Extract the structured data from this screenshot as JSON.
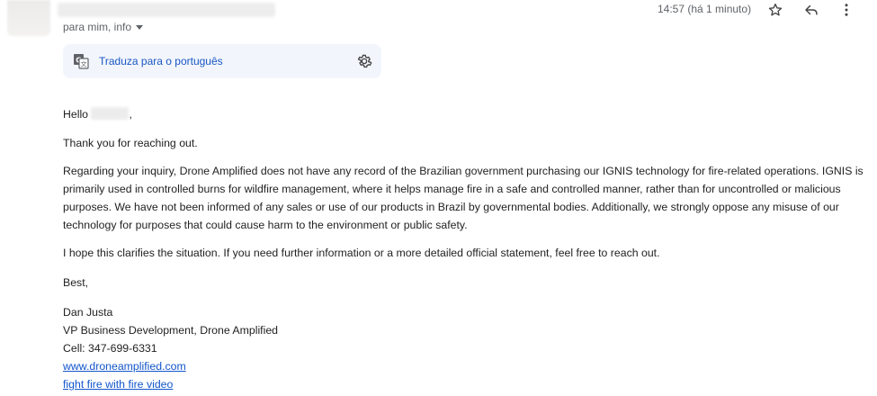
{
  "header": {
    "recipients": "para mim, info",
    "timestamp": "14:57 (há 1 minuto)",
    "icons": [
      "star-icon",
      "reply-icon",
      "more-vert-icon"
    ]
  },
  "translate": {
    "label": "Traduza para o português",
    "icons": [
      "translate-icon",
      "gear-icon"
    ]
  },
  "email": {
    "greeting": "Hello",
    "greeting_suffix": ",",
    "thanks": "Thank you for reaching out.",
    "paragraph1": "Regarding your inquiry, Drone Amplified does not have any record of the Brazilian government purchasing our IGNIS technology for fire-related operations. IGNIS is primarily used in controlled burns for wildfire management, where it helps manage fire in a safe and controlled manner, rather than for uncontrolled or malicious purposes. We have not been informed of any sales or use of our products in Brazil by governmental bodies. Additionally, we strongly oppose any misuse of our technology for purposes that could cause harm to the environment or public safety.",
    "paragraph2": "I hope this clarifies the situation. If you need further information or a more detailed official statement, feel free to reach out.",
    "closing": "Best,"
  },
  "signature": {
    "name": "Dan Justa",
    "title": "VP Business Development, Drone Amplified",
    "cell": "Cell: 347-699-6331",
    "website": "www.droneamplified.com",
    "video_link": "fight fire with fire video"
  },
  "colors": {
    "link": "#1155cc",
    "translate_link": "#1a56c4",
    "translate_bg": "#f2f6fc",
    "muted": "#5f6368",
    "text": "#222222"
  }
}
